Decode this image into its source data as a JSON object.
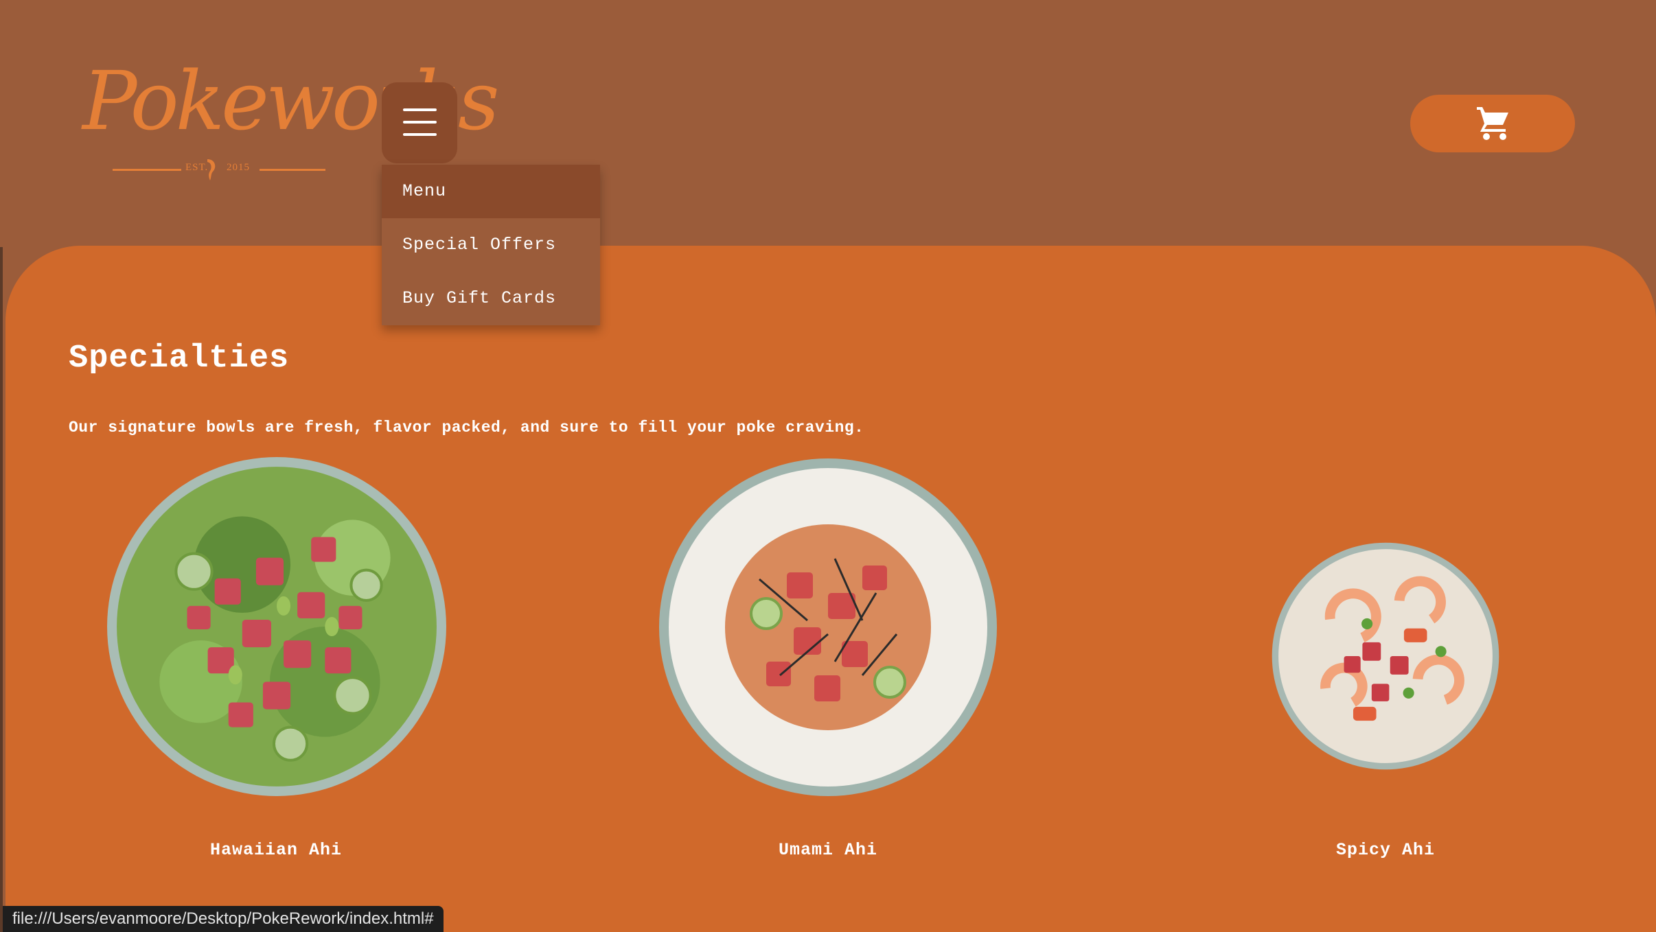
{
  "brand": {
    "logo_text": "Pokeworks",
    "est_left": "EST.",
    "est_right": "2015"
  },
  "nav": {
    "items": [
      {
        "label": "Menu"
      },
      {
        "label": "Special Offers"
      },
      {
        "label": "Buy Gift Cards"
      }
    ]
  },
  "colors": {
    "header_bg": "#9b5c3a",
    "content_bg": "#d0692b",
    "logo_orange": "#e47f37",
    "active_item_bg": "#8a4a2b"
  },
  "icons": {
    "menu": "hamburger-icon",
    "cart": "cart-icon"
  },
  "specialties": {
    "heading": "Specialties",
    "subtitle": "Our signature bowls are fresh, flavor packed, and sure to fill your poke craving.",
    "items": [
      {
        "name": "Hawaiian Ahi"
      },
      {
        "name": "Umami Ahi"
      },
      {
        "name": "Spicy Ahi"
      }
    ]
  },
  "status": {
    "url": "file:///Users/evanmoore/Desktop/PokeRework/index.html#"
  }
}
